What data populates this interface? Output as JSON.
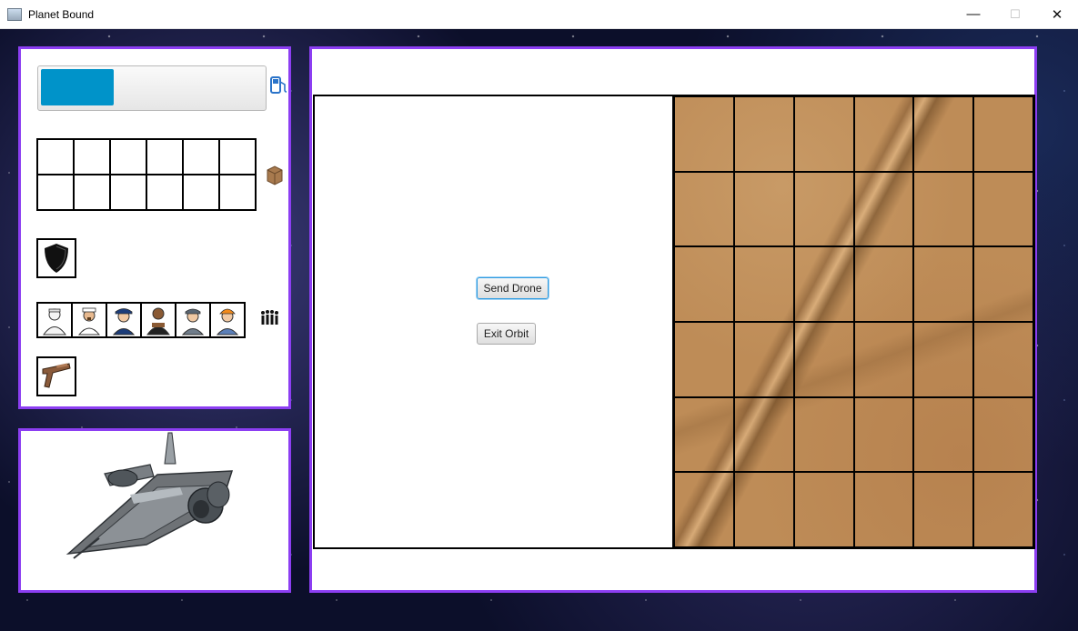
{
  "window": {
    "title": "Planet Bound"
  },
  "status_panel": {
    "fuel_level": 0.33,
    "fuel_icon": "fuel-pump-icon",
    "cargo_icon": "cargo-box-icon",
    "shield_icon": "shield-icon",
    "crew_icon": "crew-group-icon",
    "weapon_icon": "weapon-gun-icon",
    "crew": [
      "doctor-icon",
      "captain-icon",
      "navigation-officer-icon",
      "security-officer-icon",
      "science-officer-icon",
      "engineer-icon"
    ]
  },
  "main": {
    "send_drone_label": "Send Drone",
    "exit_orbit_label": "Exit Orbit"
  },
  "colors": {
    "panel_border": "#8c3ef2",
    "fuel_fill": "#0093c9",
    "focus_ring": "#2d9be0"
  }
}
